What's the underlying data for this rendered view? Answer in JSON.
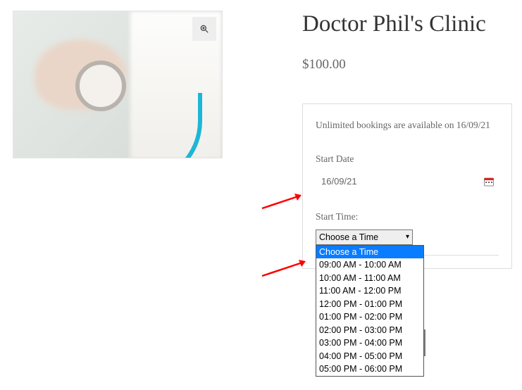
{
  "product": {
    "title": "Doctor Phil's Clinic",
    "price": "$100.00"
  },
  "booking": {
    "availability": "Unlimited bookings are available on 16/09/21",
    "date_label": "Start Date",
    "date_value": "16/09/21",
    "time_label": "Start Time:",
    "time_selected": "Choose a Time",
    "time_options": [
      "Choose a Time",
      "09:00 AM - 10:00 AM",
      "10:00 AM - 11:00 AM",
      "11:00 AM - 12:00 PM",
      "12:00 PM - 01:00 PM",
      "01:00 PM - 02:00 PM",
      "02:00 PM - 03:00 PM",
      "03:00 PM - 04:00 PM",
      "04:00 PM - 05:00 PM",
      "05:00 PM - 06:00 PM"
    ]
  },
  "icons": {
    "zoom": "magnify-icon",
    "calendar": "calendar-icon"
  }
}
